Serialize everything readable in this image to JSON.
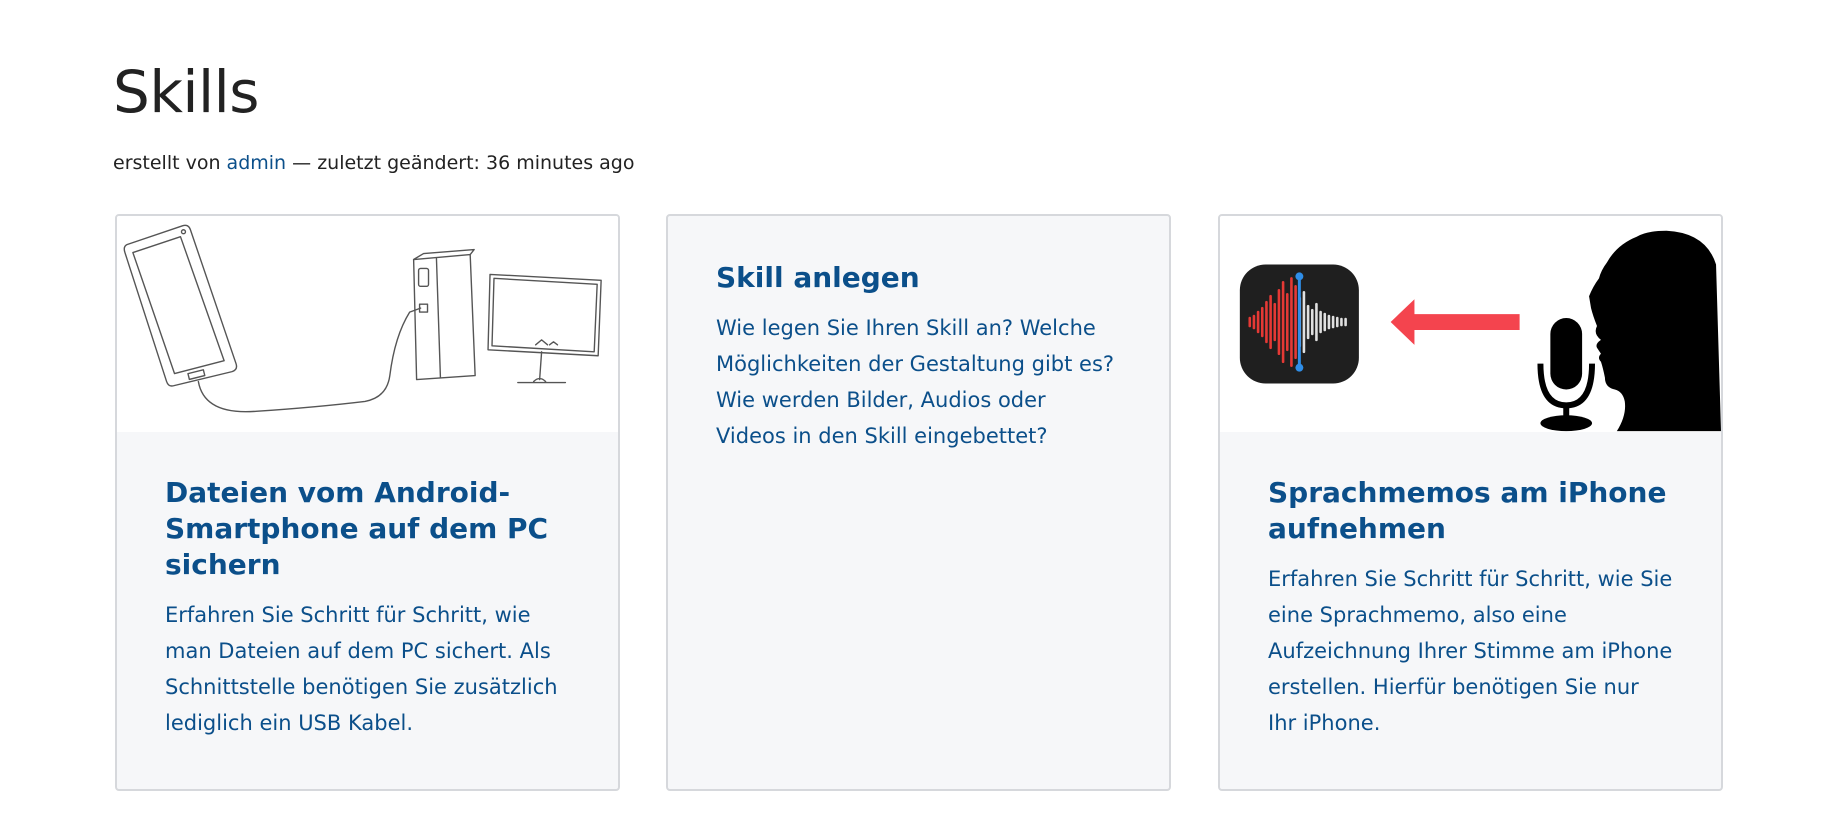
{
  "page": {
    "title": "Skills",
    "byline": {
      "prefix": "erstellt von",
      "author": "admin",
      "separator": "—",
      "modified_label": "zuletzt geändert:",
      "modified_value": "36 minutes ago"
    }
  },
  "cards": [
    {
      "title": "Dateien vom Android-Smartphone auf dem PC sichern",
      "description": "Erfahren Sie Schritt für Schritt, wie man Dateien auf dem PC sichert. Als Schnittstelle benötigen Sie zusätzlich lediglich ein USB Kabel.",
      "image": "smartphone-to-pc-sketch"
    },
    {
      "title": "Skill anlegen",
      "description": "Wie legen Sie Ihren Skill an? Welche Möglichkeiten der Gestaltung gibt es? Wie werden Bilder, Audios oder Videos in den Skill eingebettet?"
    },
    {
      "title": "Sprachmemos am iPhone aufnehmen",
      "description": "Erfahren Sie Schritt für Schritt, wie Sie eine Sprachmemo, also eine Aufzeichnung Ihrer Stimme am iPhone erstellen. Hierfür benötigen Sie nur Ihr iPhone.",
      "image": "voice-memo-microphone-silhouette"
    }
  ],
  "colors": {
    "link": "#0b4f8a",
    "card_background": "#f6f7f9",
    "card_border": "#d6d8dc",
    "waveform_red": "#e53935",
    "arrow_red": "#f4444e"
  }
}
